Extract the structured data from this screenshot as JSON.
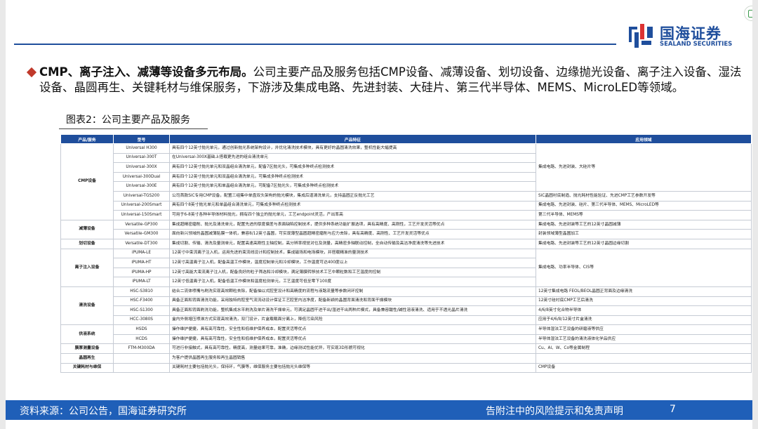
{
  "logo": {
    "cn": "国海证券",
    "en": "SEALAND SECURITIES"
  },
  "intro": {
    "bold": "CMP、离子注入、减薄等设备多元布局。",
    "rest": "公司主要产品及服务包括CMP设备、减薄设备、划切设备、边缘抛光设备、离子注入设备、湿法设备、晶圆再生、关键耗材与维保服务，下游涉及集成电路、先进封装、大硅片、第三代半导体、MEMS、MicroLED等领域。"
  },
  "figure_title": "图表2：公司主要产品及服务",
  "table": {
    "headers": [
      "产品/服务",
      "型号",
      "产品特征",
      "应用领域"
    ],
    "rows": [
      {
        "cat": "CMP设备",
        "model": "Universal H300",
        "feat": "具有四个12英寸抛光单元，通过创新抛光系统架构设计，并优化清洗技术模块，具有更好的晶圆清洗效果，整机性能大幅提高",
        "app": "集成电路、先进封装、大硅片等"
      },
      {
        "cat": "",
        "model": "Universal-300T",
        "feat": "在Universal-300X基础上搭载更先进的组合清洗单元",
        "app": ""
      },
      {
        "cat": "",
        "model": "Universal-300X",
        "feat": "具有四个12英寸抛光单元和双晶组合清洗单元，配备7区抛光头，可集成多种终点检测技术",
        "app": ""
      },
      {
        "cat": "",
        "model": "Universal-300Dual",
        "feat": "具有四个12英寸抛光单元和双晶组合清洗单元，可集成多种终点检测技术",
        "app": ""
      },
      {
        "cat": "",
        "model": "Universal-300E",
        "feat": "具有四个12英寸抛光单元和单晶组合清洗单元，可配备7区抛光头，可集成多种终点检测技术",
        "app": ""
      },
      {
        "cat": "",
        "model": "Universal-TGS200",
        "feat": "公司首款SiC专用CMP设备，配置三组集中单盘双头架构的抛光模块，集成后道清洗单元，支持晶圆正反抛光工艺",
        "app": "SiC晶圆衬底制造、抛光耗材性能验证、先进CMP工艺参数开发等"
      },
      {
        "cat": "",
        "model": "Universal-200Smart",
        "feat": "具有四个8英寸抛光单元和单晶组合清洗单元，可集成多种终点检测技术",
        "app": "集成电路、先进封装、硅片、第三代半导体、MEMS、MicroLED等"
      },
      {
        "cat": "",
        "model": "Universal-150Smart",
        "feat": "可用于6-8英寸各种半导体材料抛光，拥有四个独立的抛光单元，工艺endpoint灵活，产出率高",
        "app": "第三代半导体、MEMS等"
      },
      {
        "cat": "减薄设备",
        "model": "Versatile-GP300",
        "feat": "集成超精密磨削、抛光及清洗单元，配置先进的厚度偏差与表面缺陷控制技术，提供多种系统功能扩展选项，具有高精度、高刚性，工艺开发灵活等优点",
        "app": "集成电路、先进封装等工艺的12英寸晶圆减薄"
      },
      {
        "cat": "",
        "model": "Versatile-GM300",
        "feat": "面向新兴领域的晶圆减薄贴膜一体机，兼容8/12英寸晶圆，可实现薄型晶圆超精密磨削与应力去除，具有高精度、高刚性、工艺开发灵活等优点",
        "app": "封装领域薄型晶圆加工"
      },
      {
        "cat": "划切设备",
        "model": "Versatile-DT300",
        "feat": "集成切割、传输、清洗及量测单元，配置高速高刚性主轴控制，高分辨率视觉对位及测量，高精密多轴联动控制，全自动传输及高洁净度清洗等先进技术",
        "app": "集成电路、先进封装等工艺的12英寸晶圆边缘切割"
      },
      {
        "cat": "离子注入设备",
        "model": "iPUMA-LE",
        "feat": "12英寸中束流离子注入机，运用先进的束流线设计和控制技术，集成磁场和电场模块，并搭载精准的量测技术",
        "app": "集成电路、功率半导体、CIS等"
      },
      {
        "cat": "",
        "model": "iPUMA-HT",
        "feat": "12英寸高温离子注入机，配备高温工作模块，温度控制单元和冷却模块，工作温度可达400度以上",
        "app": ""
      },
      {
        "cat": "",
        "model": "iPUMA-HP",
        "feat": "12英寸高能大束流离子注入机，配备良好的粒子筛选和冷却模块，满足薄膜转移技术工艺中颗粒数和工艺温度的控制",
        "app": ""
      },
      {
        "cat": "",
        "model": "iPUMA-LT",
        "feat": "12英寸低温离子注入机，配备低温工作模块和温度检测单元，工艺温度可低至零下100度",
        "app": ""
      },
      {
        "cat": "清洗设备",
        "model": "HSC-S3810",
        "feat": "结合二流体喷嘴与刷洗实现高效颗粒去除，配备抽以式腔室设计和高精度的流程与液路流量等参数闭环控制",
        "app": "12英寸集成电路 FEOL/BEOL晶圆正背面及边缘清洗"
      },
      {
        "cat": "",
        "model": "HSC-F3400",
        "feat": "具备正面和背面清洗功能，采用独特的腔室气流流动设计保证工艺腔室内洁净度，配备新颖的晶圆背面清洗和背面干燥模块",
        "app": "12英寸硅衬底CMP工艺后清洗"
      },
      {
        "cat": "",
        "model": "HSC-S1300",
        "feat": "具备正面和背面刷洗功能，整机集成水平刷洗及单片清洗干燥单元，可满足晶圆干进干出/湿进干出两种片模式，具备兼容酸性/碱性溶液清洗、适用于不透光晶片清洗",
        "app": "4/6/8英寸化合物半导体"
      },
      {
        "cat": "",
        "model": "HCC-3080S",
        "feat": "盒内外侧增压喷淋方式实现高效清洗，双门设计，片盒载载面分离上，降低污染风险",
        "app": "应用于4/6/8/12英寸片盒清洗"
      },
      {
        "cat": "供液系统",
        "model": "HSDS",
        "feat": "操作维护便捷，具有高可靠性，安全性和低维护保养成本，配置灵活等优点",
        "app": "半导体湿法工艺设备的研磨液等供应"
      },
      {
        "cat": "",
        "model": "HCDS",
        "feat": "操作维护便捷，具有高可靠性，安全性和低维护保养成本，配置灵活等优点",
        "app": "半导体湿法工艺设备的清洗液体化学品供应"
      },
      {
        "cat": "膜厚测量设备",
        "model": "FTM-M300DA",
        "feat": "可进行非接触式，具有高可靠性，精度高，测量结果可靠，准确，边缘测试性能优异，可实现3D形貌可视化",
        "app": "Cu、Al、W、Co等金属制程"
      },
      {
        "cat": "晶圆再生",
        "model": "",
        "feat": "为客户提供晶圆再生服务和再生晶圆销售",
        "app": ""
      },
      {
        "cat": "关键耗材与维保",
        "model": "",
        "feat": "关键耗材主要包括抛光头，保持环，气膜等，维保服务主要包括抛光头维保等",
        "app": "CMP设备"
      }
    ]
  },
  "footer": {
    "source": "资料来源：公司公告，国海证券研究所",
    "disclaimer": "告附注中的风险提示和免责声明",
    "page": "7"
  },
  "colors": {
    "brand": "#1f4e9c",
    "footer": "#1f5fb8",
    "bullet": "#c0392b"
  }
}
